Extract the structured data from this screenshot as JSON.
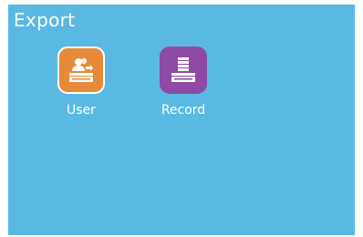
{
  "header": {
    "title": "Export"
  },
  "items": [
    {
      "label": "User",
      "icon": "user-export-icon",
      "color": "#e48a3a"
    },
    {
      "label": "Record",
      "icon": "record-export-icon",
      "color": "#8e4aa5"
    }
  ],
  "colors": {
    "background": "#5ab9e2",
    "text": "#ffffff"
  }
}
